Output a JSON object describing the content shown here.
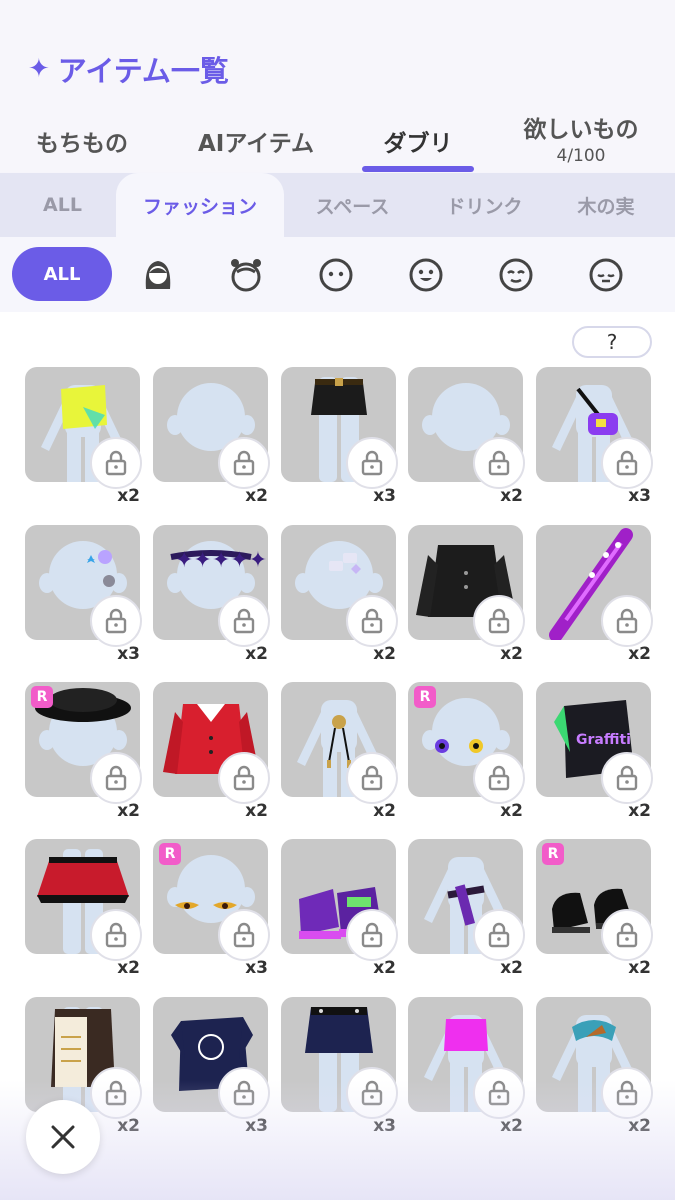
{
  "header": {
    "title": "アイテム一覧"
  },
  "tabs": [
    {
      "label": "もちもの"
    },
    {
      "label": "AIアイテム"
    },
    {
      "label": "ダブリ"
    },
    {
      "label": "欲しいもの",
      "sub": "4/100"
    }
  ],
  "subtabs": [
    {
      "label": "ALL"
    },
    {
      "label": "ファッション"
    },
    {
      "label": "スペース"
    },
    {
      "label": "ドリンク"
    },
    {
      "label": "木の実"
    }
  ],
  "categories": {
    "all_label": "ALL",
    "icons": [
      "hair-icon",
      "head-accessory-icon",
      "face-neutral-icon",
      "face-smile-icon",
      "face-happy-icon",
      "face-sad-icon"
    ]
  },
  "help_label": "?",
  "colors": {
    "accent": "#6b5ce7",
    "rare_badge": "#f25cc9",
    "tile": "#c8c8c8"
  },
  "rare_badge_label": "R",
  "items": [
    {
      "count": "x2",
      "rare": false,
      "art": "yellow-top"
    },
    {
      "count": "x2",
      "rare": false,
      "art": "body-plain"
    },
    {
      "count": "x3",
      "rare": false,
      "art": "black-skirt"
    },
    {
      "count": "x2",
      "rare": false,
      "art": "body-plain"
    },
    {
      "count": "x3",
      "rare": false,
      "art": "purple-bag"
    },
    {
      "count": "x3",
      "rare": false,
      "art": "hair-clips"
    },
    {
      "count": "x2",
      "rare": false,
      "art": "star-headband"
    },
    {
      "count": "x2",
      "rare": false,
      "art": "hair-pins"
    },
    {
      "count": "x2",
      "rare": false,
      "art": "black-jacket"
    },
    {
      "count": "x2",
      "rare": false,
      "art": "spiked-bat"
    },
    {
      "count": "x2",
      "rare": true,
      "art": "black-hat"
    },
    {
      "count": "x2",
      "rare": false,
      "art": "red-cardigan"
    },
    {
      "count": "x2",
      "rare": false,
      "art": "bolo-tie"
    },
    {
      "count": "x2",
      "rare": true,
      "art": "odd-eyes"
    },
    {
      "count": "x2",
      "rare": false,
      "art": "graffiti-tee"
    },
    {
      "count": "x2",
      "rare": false,
      "art": "red-skirt"
    },
    {
      "count": "x3",
      "rare": true,
      "art": "gold-eyes"
    },
    {
      "count": "x2",
      "rare": false,
      "art": "sneakers"
    },
    {
      "count": "x2",
      "rare": false,
      "art": "belt"
    },
    {
      "count": "x2",
      "rare": true,
      "art": "loafers"
    },
    {
      "count": "x2",
      "rare": false,
      "art": "apron-skirt"
    },
    {
      "count": "x3",
      "rare": false,
      "art": "navy-tee"
    },
    {
      "count": "x3",
      "rare": false,
      "art": "navy-shorts"
    },
    {
      "count": "x2",
      "rare": false,
      "art": "pink-top"
    },
    {
      "count": "x2",
      "rare": false,
      "art": "scarf"
    }
  ]
}
